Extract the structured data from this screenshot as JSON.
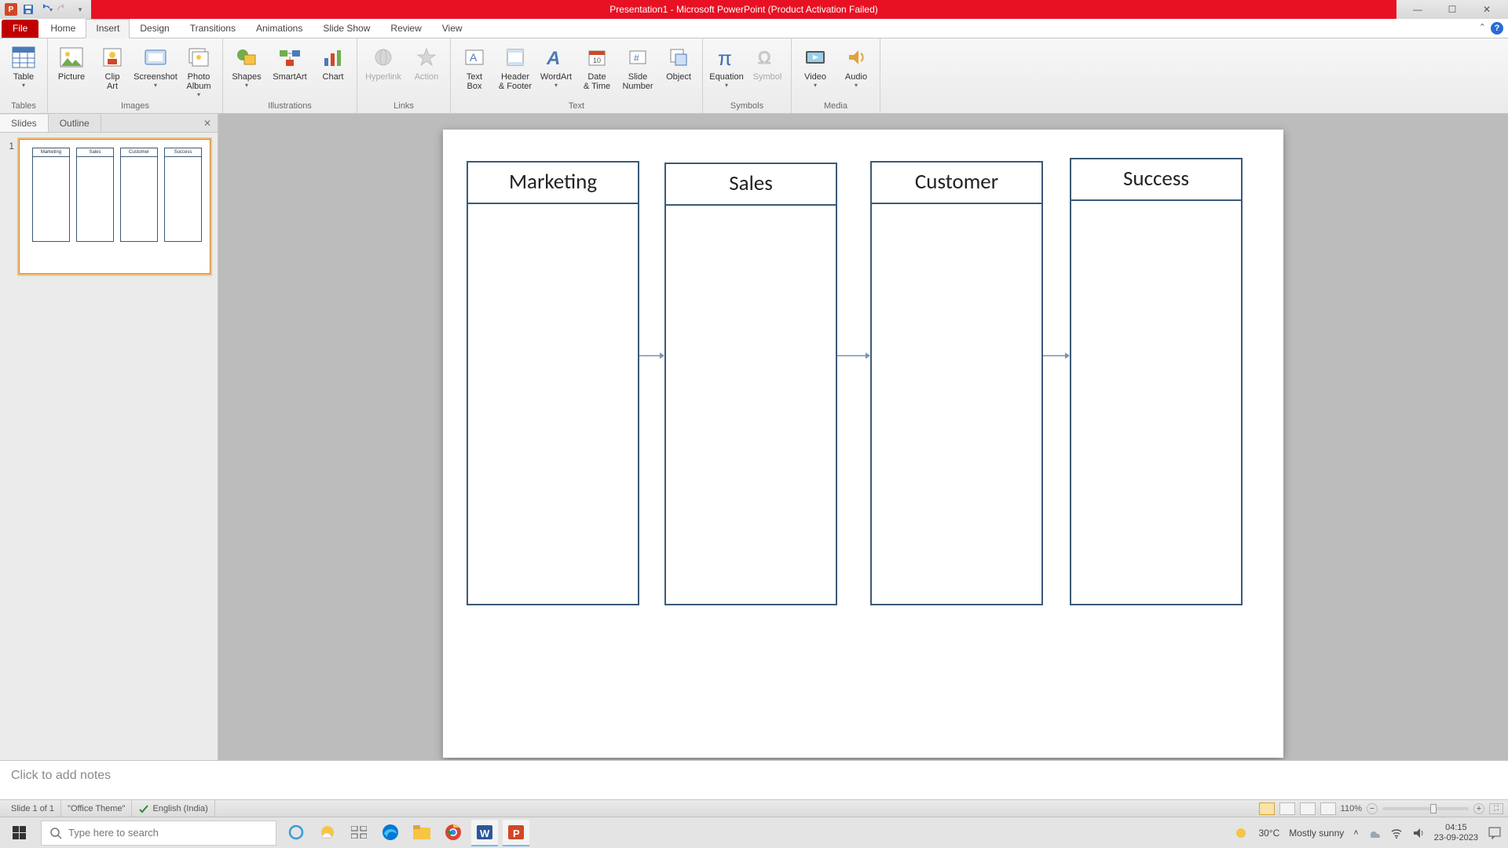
{
  "app": {
    "title": "Presentation1 - Microsoft PowerPoint (Product Activation Failed)"
  },
  "tabs": {
    "file": "File",
    "items": [
      "Home",
      "Insert",
      "Design",
      "Transitions",
      "Animations",
      "Slide Show",
      "Review",
      "View"
    ],
    "active": "Insert"
  },
  "ribbon": {
    "groups": {
      "tables": {
        "label": "Tables",
        "table": "Table"
      },
      "images": {
        "label": "Images",
        "picture": "Picture",
        "clipart": "Clip\nArt",
        "screenshot": "Screenshot",
        "album": "Photo\nAlbum"
      },
      "illustrations": {
        "label": "Illustrations",
        "shapes": "Shapes",
        "smartart": "SmartArt",
        "chart": "Chart"
      },
      "links": {
        "label": "Links",
        "hyperlink": "Hyperlink",
        "action": "Action"
      },
      "text": {
        "label": "Text",
        "textbox": "Text\nBox",
        "header": "Header\n& Footer",
        "wordart": "WordArt",
        "date": "Date\n& Time",
        "slidenum": "Slide\nNumber",
        "object": "Object"
      },
      "symbols": {
        "label": "Symbols",
        "equation": "Equation",
        "symbol": "Symbol"
      },
      "media": {
        "label": "Media",
        "video": "Video",
        "audio": "Audio"
      }
    }
  },
  "leftpane": {
    "slides_tab": "Slides",
    "outline_tab": "Outline",
    "thumb_number": "1"
  },
  "slide": {
    "columns": [
      "Marketing",
      "Sales",
      "Customer",
      "Success"
    ]
  },
  "notes": {
    "placeholder": "Click to add notes"
  },
  "status": {
    "slide": "Slide 1 of 1",
    "theme": "\"Office Theme\"",
    "lang": "English (India)",
    "zoom": "110%"
  },
  "taskbar": {
    "search_placeholder": "Type here to search",
    "weather_temp": "30°C",
    "weather_desc": "Mostly sunny",
    "time": "04:15",
    "date": "23-09-2023"
  },
  "thumb_labels": {
    "c0": "Marketing",
    "c1": "Sales",
    "c2": "Customer",
    "c3": "Success"
  }
}
